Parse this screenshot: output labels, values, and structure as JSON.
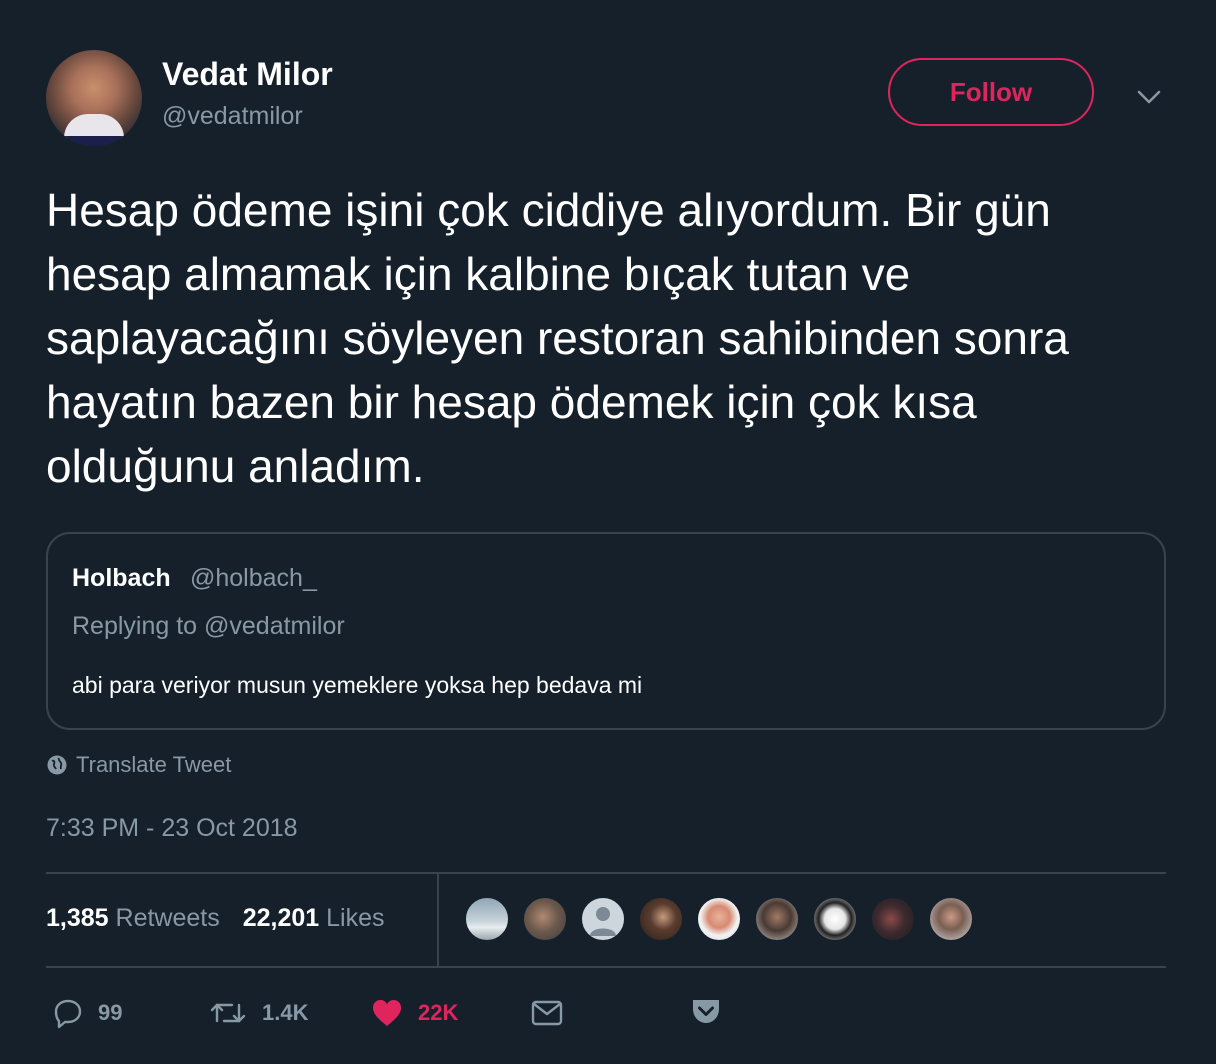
{
  "tweet": {
    "author": {
      "display_name": "Vedat Milor",
      "handle": "@vedatmilor"
    },
    "follow_label": "Follow",
    "text": "Hesap ödeme işini çok ciddiye alıyordum. Bir gün hesap almamak için kalbine bıçak tutan ve saplayacağını söyleyen restoran sahibinden sonra hayatın bazen bir hesap ödemek için çok kısa olduğunu anladım.",
    "quoted": {
      "name": "Holbach",
      "handle": "@holbach_",
      "replying_to": "Replying to @vedatmilor",
      "text": "abi para veriyor musun yemeklere yoksa hep bedava mi"
    },
    "translate_label": "Translate Tweet",
    "timestamp": "7:33 PM - 23 Oct 2018",
    "stats": {
      "retweets_count": "1,385",
      "retweets_label": "Retweets",
      "likes_count": "22,201",
      "likes_label": "Likes"
    },
    "actions": {
      "replies": "99",
      "retweets": "1.4K",
      "likes": "22K"
    }
  },
  "icons": [
    "chevron-down-icon",
    "globe-icon",
    "reply-icon",
    "retweet-icon",
    "heart-icon",
    "message-icon",
    "pocket-icon"
  ],
  "colors": {
    "background": "#15202b",
    "accent": "#e0245e",
    "muted": "#8899a6",
    "border": "#38444d"
  }
}
